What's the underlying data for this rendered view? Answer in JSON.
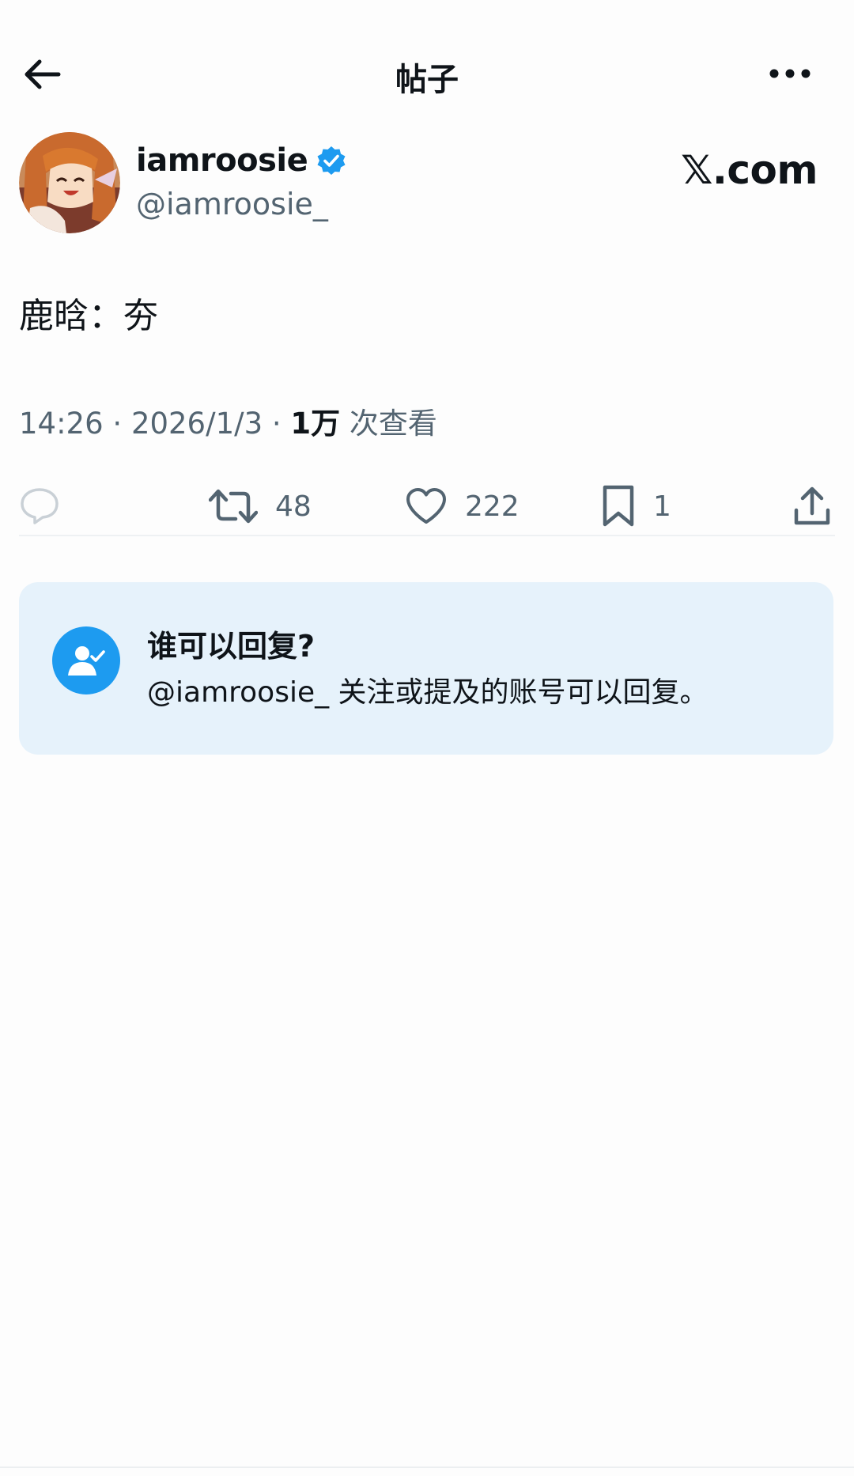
{
  "nav": {
    "title": "帖子",
    "back_icon": "arrow-left-icon",
    "more_icon": "more-horizontal-icon"
  },
  "author": {
    "display_name": "iamroosie",
    "handle": "@iamroosie_",
    "verified_icon": "verified-badge-icon",
    "verified_color": "#1d9bf0"
  },
  "brand": "𝕏.com",
  "post": {
    "text": "鹿晗：夯",
    "time": "14:26",
    "sep1": " · ",
    "date": "2026/1/3",
    "sep2": " · ",
    "views_count": "1万",
    "views_label": " 次查看"
  },
  "actions": {
    "reply_icon": "reply-bubble-icon",
    "retweet_icon": "retweet-icon",
    "retweet_count": "48",
    "like_icon": "heart-icon",
    "like_count": "222",
    "bookmark_icon": "bookmark-icon",
    "bookmark_count": "1",
    "share_icon": "share-icon"
  },
  "reply_settings": {
    "title": "谁可以回复?",
    "description": "@iamroosie_ 关注或提及的账号可以回复。",
    "icon": "user-check-icon",
    "accent": "#1d9bf0",
    "background": "#e6f2fb"
  }
}
